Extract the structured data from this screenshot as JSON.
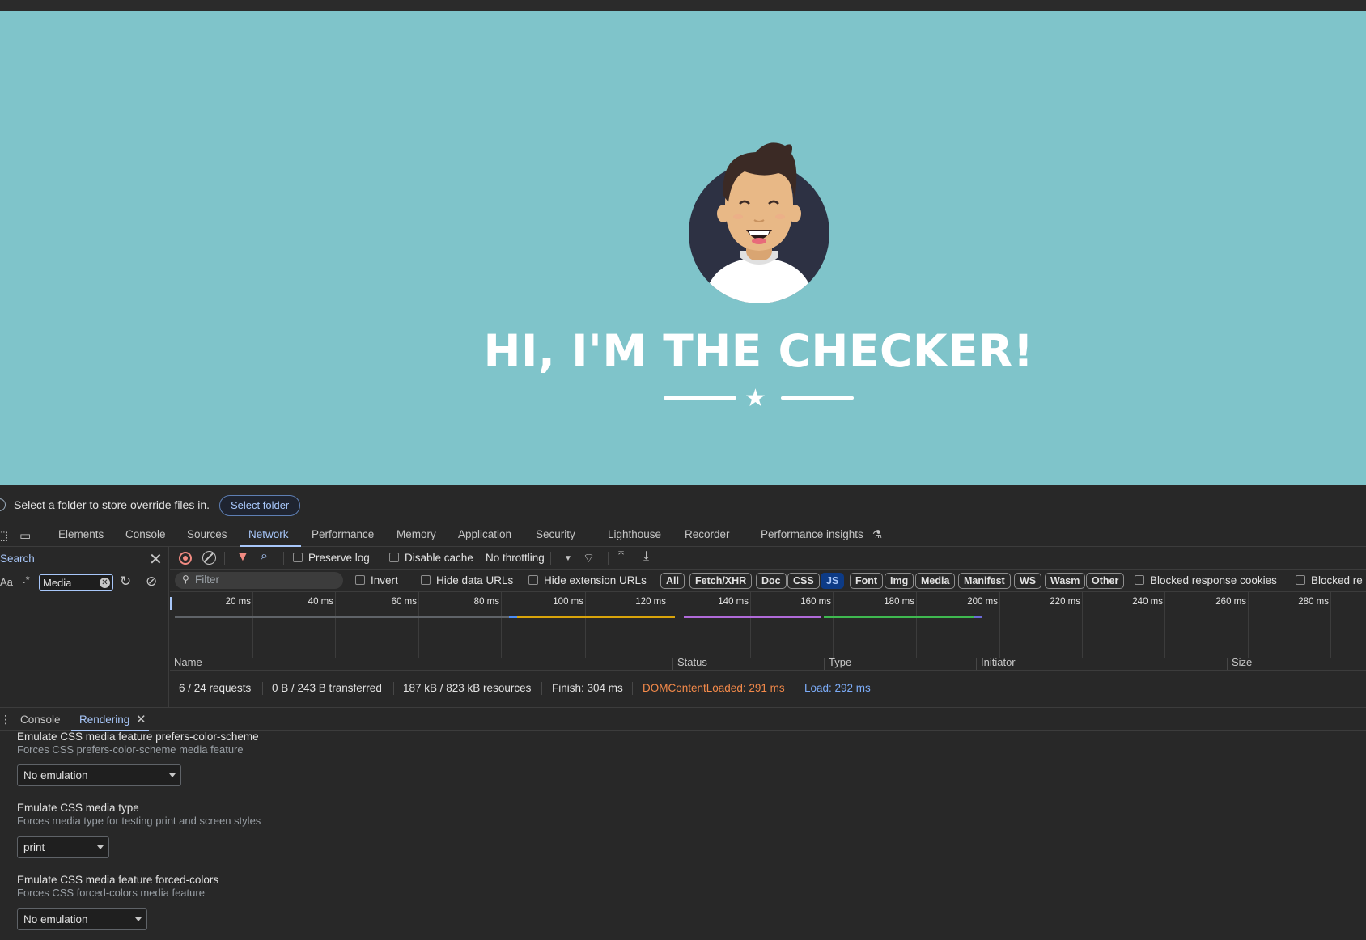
{
  "page": {
    "hero_title": "HI, I'M THE CHECKER!",
    "viewport_bg": "#7fc4ca"
  },
  "infobar": {
    "message": "Select a folder to store override files in.",
    "button": "Select folder",
    "icon": "info-icon"
  },
  "devtools_tabs": [
    {
      "label": "Elements"
    },
    {
      "label": "Console"
    },
    {
      "label": "Sources"
    },
    {
      "label": "Network",
      "active": true
    },
    {
      "label": "Performance"
    },
    {
      "label": "Memory"
    },
    {
      "label": "Application"
    },
    {
      "label": "Security"
    },
    {
      "label": "Lighthouse"
    },
    {
      "label": "Recorder"
    },
    {
      "label": "Performance insights"
    }
  ],
  "search_pane": {
    "title": "Search",
    "case_toggle": "Aa",
    "regex_toggle": ".*",
    "query": "Media"
  },
  "network": {
    "toolbar": {
      "preserve_log": "Preserve log",
      "disable_cache": "Disable cache",
      "throttling": "No throttling"
    },
    "filter": {
      "placeholder": "Filter",
      "invert": "Invert",
      "hide_data_urls": "Hide data URLs",
      "hide_extension_urls": "Hide extension URLs",
      "types": [
        "All",
        "Fetch/XHR",
        "Doc",
        "CSS",
        "JS",
        "Font",
        "Img",
        "Media",
        "Manifest",
        "WS",
        "Wasm",
        "Other"
      ],
      "selected_type": "JS",
      "blocked_cookies": "Blocked response cookies",
      "blocked_requests": "Blocked re"
    },
    "timeline_ticks": [
      "20 ms",
      "40 ms",
      "60 ms",
      "80 ms",
      "100 ms",
      "120 ms",
      "140 ms",
      "160 ms",
      "180 ms",
      "200 ms",
      "220 ms",
      "240 ms",
      "260 ms",
      "280 ms"
    ],
    "columns": [
      "Name",
      "Status",
      "Type",
      "Initiator",
      "Size"
    ],
    "summary": {
      "requests": "6 / 24 requests",
      "transferred": "0 B / 243 B transferred",
      "resources": "187 kB / 823 kB resources",
      "finish": "Finish: 304 ms",
      "dom_content_loaded": "DOMContentLoaded: 291 ms",
      "load": "Load: 292 ms"
    }
  },
  "drawer": {
    "tabs": [
      "Console",
      "Rendering"
    ],
    "active": "Rendering"
  },
  "rendering": {
    "color_scheme_title": "Emulate CSS media feature prefers-color-scheme",
    "color_scheme_desc": "Forces CSS prefers-color-scheme media feature",
    "color_scheme_value": "No emulation",
    "media_type_title": "Emulate CSS media type",
    "media_type_desc": "Forces media type for testing print and screen styles",
    "media_type_value": "print",
    "forced_colors_title": "Emulate CSS media feature forced-colors",
    "forced_colors_desc": "Forces CSS forced-colors media feature",
    "forced_colors_value": "No emulation"
  },
  "colors": {
    "accent": "#a8c7fa",
    "dcl": "#f48a4a",
    "load": "#7cacf8",
    "record": "#f28b82"
  }
}
